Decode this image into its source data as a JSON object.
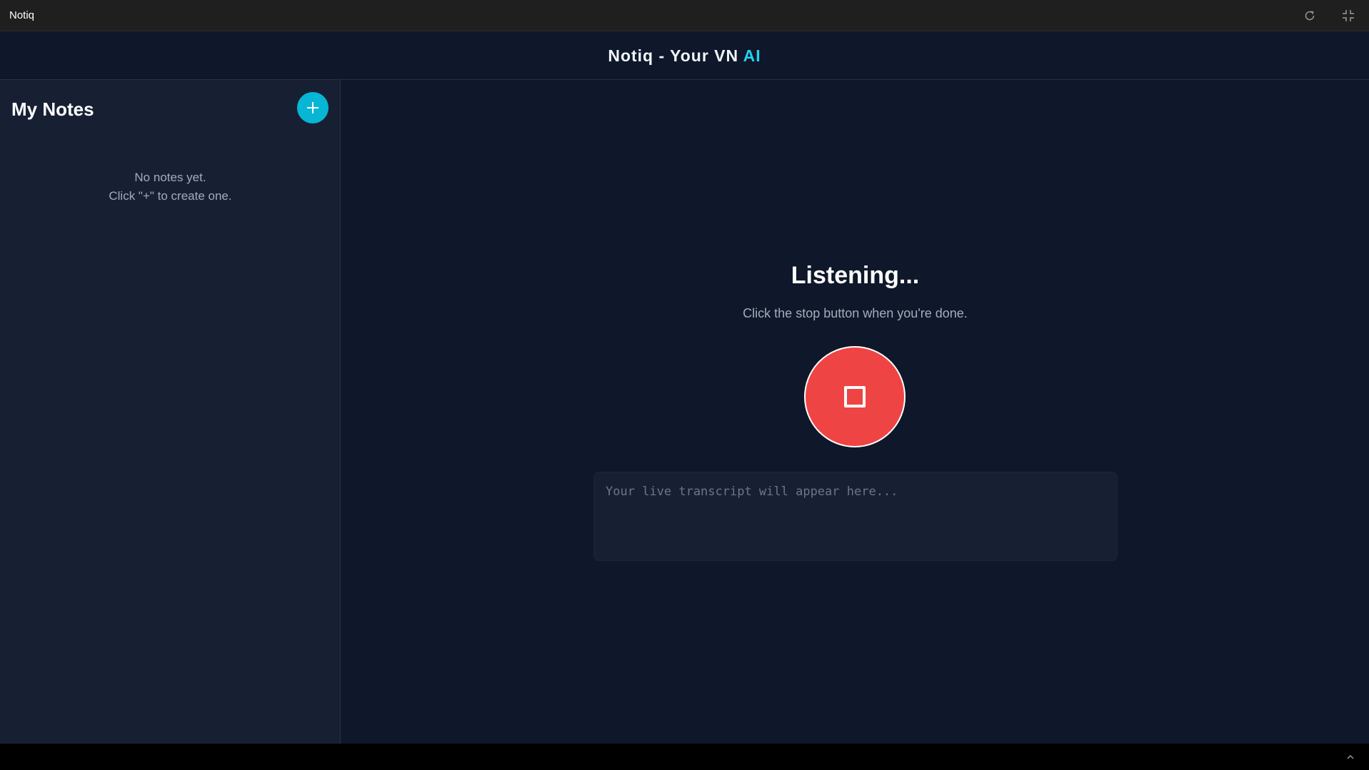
{
  "window": {
    "title": "Notiq",
    "icons": [
      "refresh-icon",
      "exit-fullscreen-icon"
    ]
  },
  "header": {
    "brand_main": "Notiq - Your VN ",
    "brand_accent": "AI",
    "accent_color": "#22d3ee"
  },
  "sidebar": {
    "heading": "My Notes",
    "add_button_label": "+",
    "empty_line1": "No notes yet.",
    "empty_line2": "Click \"+\" to create one."
  },
  "main": {
    "status_title": "Listening...",
    "status_subtitle": "Click the stop button when you're done.",
    "stop_button_color": "#ef4444",
    "transcript_placeholder": "Your live transcript will appear here..."
  },
  "bottom": {
    "icon": "chevron-up-icon"
  }
}
